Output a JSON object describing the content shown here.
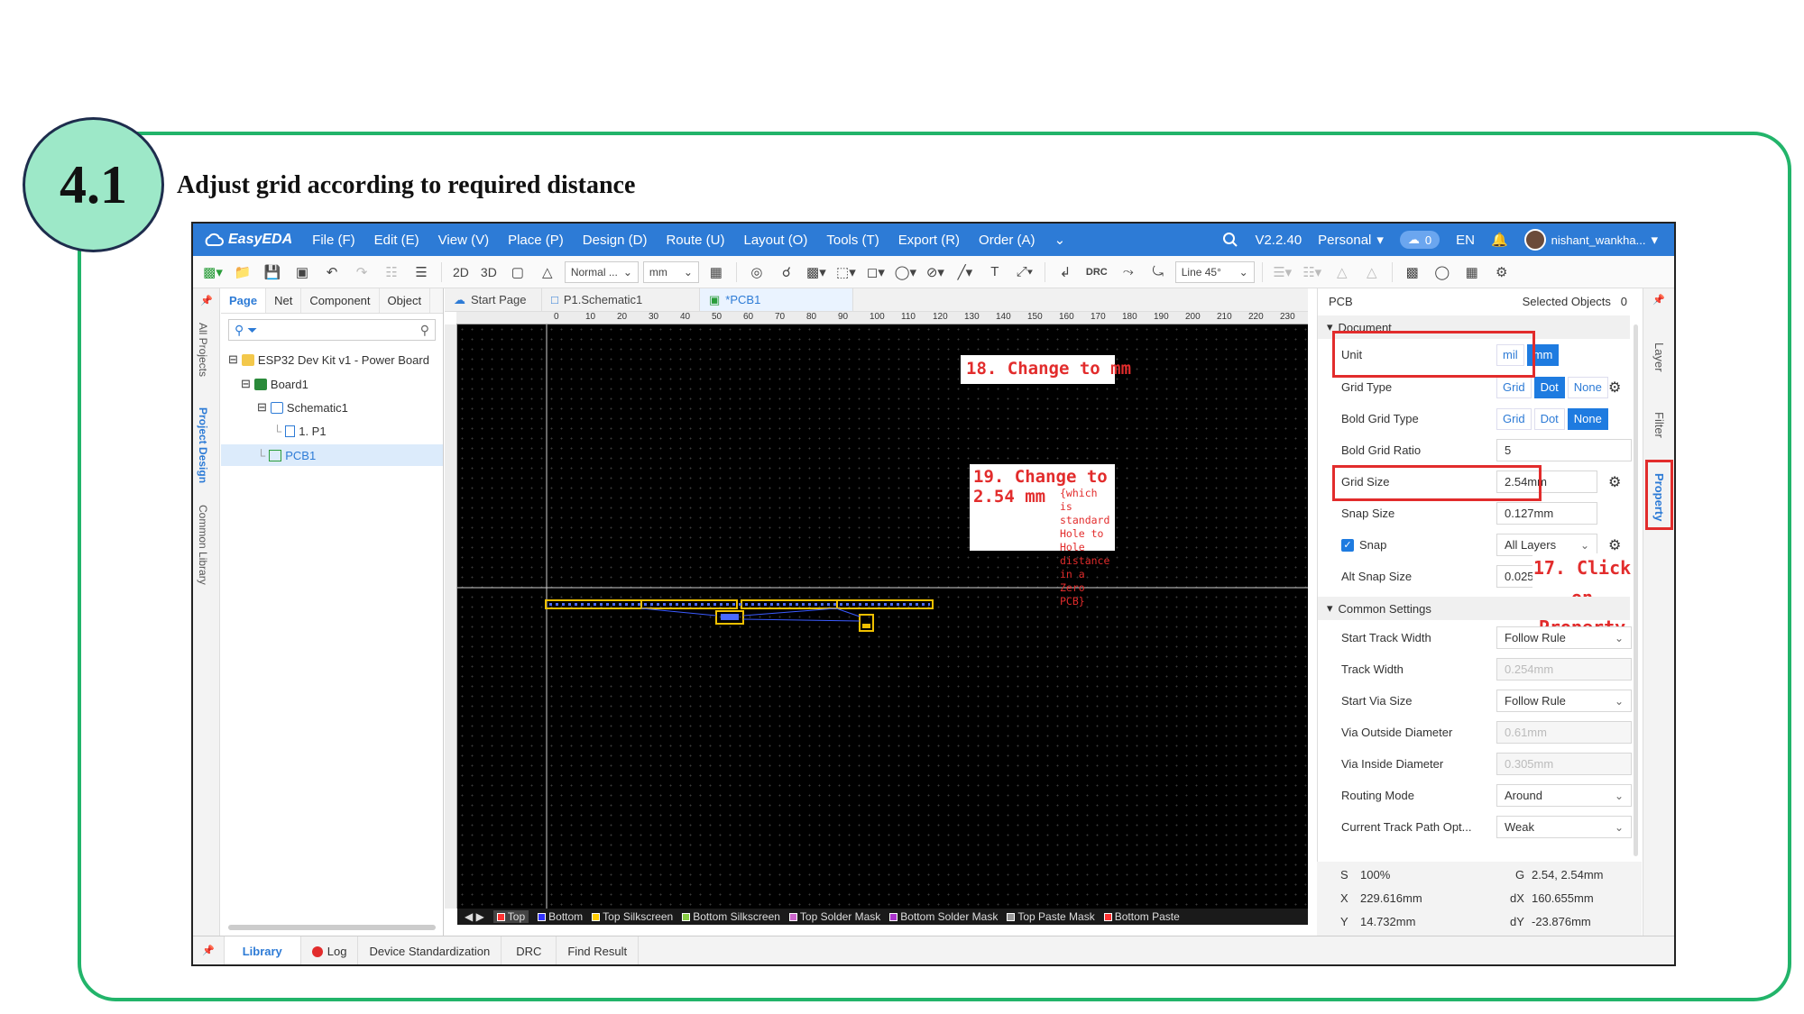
{
  "slide": {
    "step_number": "4.1",
    "heading": "Adjust grid according to required distance"
  },
  "menubar": {
    "logo": "EasyEDA",
    "menus": [
      "File (F)",
      "Edit (E)",
      "View (V)",
      "Place (P)",
      "Design (D)",
      "Route (U)",
      "Layout (O)",
      "Tools (T)",
      "Export (R)",
      "Order (A)"
    ],
    "version": "V2.2.40",
    "edition": "Personal",
    "cloud_count": "0",
    "language": "EN",
    "username": "nishant_wankha..."
  },
  "toolbar": {
    "view_2d": "2D",
    "view_3d": "3D",
    "mode_select": "Normal ...",
    "unit_select": "mm",
    "drc_label": "DRC",
    "line_angle": "Line 45°"
  },
  "left_strip": [
    "All Projects",
    "Project Design",
    "Common Library"
  ],
  "left_panel": {
    "tabs": [
      "Page",
      "Net",
      "Component",
      "Object"
    ],
    "tree": {
      "project": "ESP32 Dev Kit v1 - Power Board",
      "board": "Board1",
      "schematic": "Schematic1",
      "page": "1. P1",
      "pcb": "PCB1"
    }
  },
  "doc_tabs": [
    "Start Page",
    "P1.Schematic1",
    "*PCB1"
  ],
  "ruler": {
    "top_labels": [
      "0",
      "10",
      "20",
      "30",
      "40",
      "50",
      "60",
      "70",
      "80",
      "90",
      "100",
      "110",
      "120",
      "130",
      "140",
      "150",
      "160",
      "170",
      "180",
      "190",
      "200",
      "210",
      "220",
      "230"
    ]
  },
  "canvas": {
    "annotation_18": "18. Change to mm",
    "annotation_19_title": "19. Change to",
    "annotation_19_value": "2.54 mm",
    "annotation_19_note": "{which is standard Hole to Hole distance in a Zero PCB}"
  },
  "layers": [
    "Top",
    "Bottom",
    "Top Silkscreen",
    "Bottom Silkscreen",
    "Top Solder Mask",
    "Bottom Solder Mask",
    "Top Paste Mask",
    "Bottom Paste"
  ],
  "layer_colors": [
    "#ff3333",
    "#3333ff",
    "#ffcc00",
    "#88cc44",
    "#cc66cc",
    "#aa33cc",
    "#999999",
    "#ff3333"
  ],
  "property_panel": {
    "context": "PCB",
    "selected_label": "Selected Objects",
    "selected_count": "0",
    "document_section": "Document",
    "unit": {
      "label": "Unit",
      "options": [
        "mil",
        "mm"
      ],
      "selected": "mm"
    },
    "grid_type": {
      "label": "Grid Type",
      "options": [
        "Grid",
        "Dot",
        "None"
      ],
      "selected": "Dot"
    },
    "bold_grid_type": {
      "label": "Bold Grid Type",
      "options": [
        "Grid",
        "Dot",
        "None"
      ],
      "selected": "None"
    },
    "bold_grid_ratio": {
      "label": "Bold Grid Ratio",
      "value": "5"
    },
    "grid_size": {
      "label": "Grid Size",
      "value": "2.54mm"
    },
    "snap_size": {
      "label": "Snap Size",
      "value": "0.127mm"
    },
    "snap": {
      "label": "Snap",
      "checked": true,
      "scope": "All Layers"
    },
    "alt_snap_size": {
      "label": "Alt Snap Size",
      "value": "0.025r"
    },
    "annotation_17": "17. Click on Property",
    "common_section": "Common Settings",
    "start_track_width": {
      "label": "Start Track Width",
      "value": "Follow Rule"
    },
    "track_width": {
      "label": "Track Width",
      "value": "0.254mm"
    },
    "start_via_size": {
      "label": "Start Via Size",
      "value": "Follow Rule"
    },
    "via_outside_diameter": {
      "label": "Via Outside Diameter",
      "value": "0.61mm"
    },
    "via_inside_diameter": {
      "label": "Via Inside Diameter",
      "value": "0.305mm"
    },
    "routing_mode": {
      "label": "Routing Mode",
      "value": "Around"
    },
    "track_path_opt": {
      "label": "Current Track Path Opt...",
      "value": "Weak"
    }
  },
  "status": {
    "s_label": "S",
    "s_value": "100%",
    "g_label": "G",
    "g_value": "2.54, 2.54mm",
    "x_label": "X",
    "x_value": "229.616mm",
    "dx_label": "dX",
    "dx_value": "160.655mm",
    "y_label": "Y",
    "y_value": "14.732mm",
    "dy_label": "dY",
    "dy_value": "-23.876mm"
  },
  "right_strip": [
    "Layer",
    "Filter",
    "Property"
  ],
  "bottom_tabs": [
    "Library",
    "Log",
    "Device Standardization",
    "DRC",
    "Find Result"
  ],
  "colors": {
    "accent": "#2d7bd6",
    "annotation": "#e22c2c",
    "frame": "#22b46a",
    "step_circle": "#9de8c8"
  }
}
